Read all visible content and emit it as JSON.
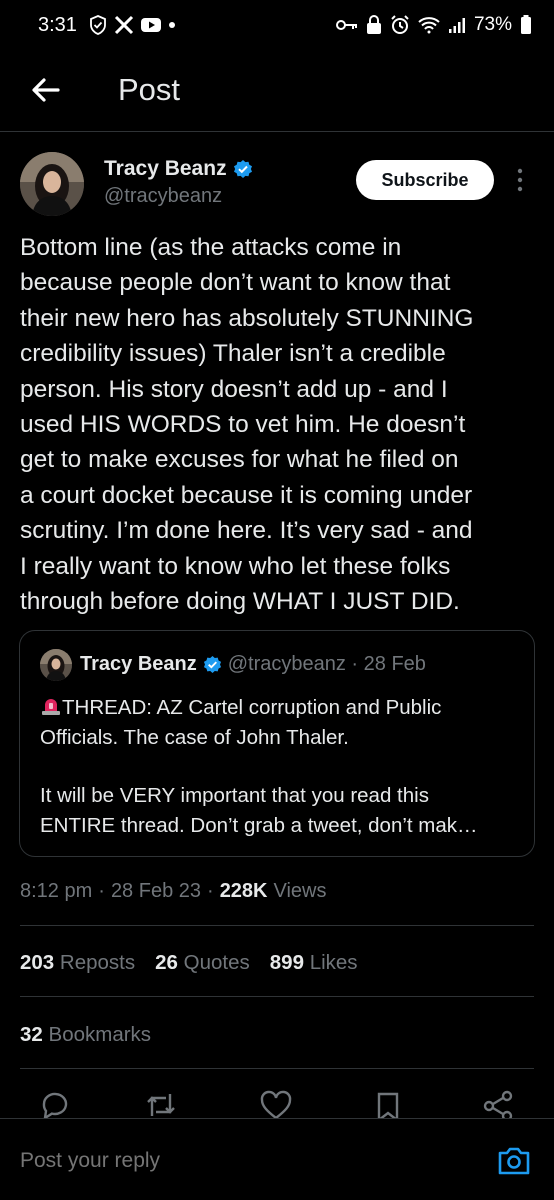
{
  "status_bar": {
    "time": "3:31",
    "battery": "73%",
    "left_icons": [
      "shield-check-icon",
      "x-logo-icon",
      "youtube-icon",
      "dot-icon"
    ],
    "right_icons": [
      "key-icon",
      "lock-icon",
      "alarm-icon",
      "wifi-icon",
      "signal-icon",
      "battery-icon"
    ]
  },
  "header": {
    "title": "Post"
  },
  "post": {
    "author_name": "Tracy Beanz",
    "author_handle": "@tracybeanz",
    "subscribe_label": "Subscribe",
    "text": "Bottom line (as the attacks come in\nbecause people don’t want to know that\ntheir new hero has absolutely STUNNING\ncredibility issues) Thaler isn’t a credible\nperson. His story doesn’t add up - and I\nused HIS WORDS to vet him. He doesn’t\nget to make excuses for what he filed on\na court docket because it is coming under\nscrutiny. I’m done here. It’s very sad - and\nI really want to know who let these folks\nthrough before doing WHAT I JUST DID.",
    "time": "8:12 pm",
    "date": "28 Feb 23",
    "views_count": "228K",
    "views_label": "Views"
  },
  "quote": {
    "author_name": "Tracy Beanz",
    "meta": "@tracybeanz · 28 Feb",
    "text_line1": "THREAD: AZ Cartel corruption and Public\nOfficials. The case of John Thaler.",
    "text_line2": "It will be VERY important that you read this\nENTIRE thread. Don’t grab a tweet, don’t mak…"
  },
  "stats": {
    "reposts_count": "203",
    "reposts_label": "Reposts",
    "quotes_count": "26",
    "quotes_label": "Quotes",
    "likes_count": "899",
    "likes_label": "Likes",
    "bookmarks_count": "32",
    "bookmarks_label": "Bookmarks"
  },
  "actions": [
    "reply-icon",
    "repost-icon",
    "like-icon",
    "bookmark-icon",
    "share-icon"
  ],
  "reply": {
    "placeholder": "Post your reply"
  },
  "colors": {
    "background": "#000000",
    "text": "#e7e9ea",
    "muted": "#71767b",
    "accent": "#1d9bf0",
    "border": "#2f3336"
  }
}
